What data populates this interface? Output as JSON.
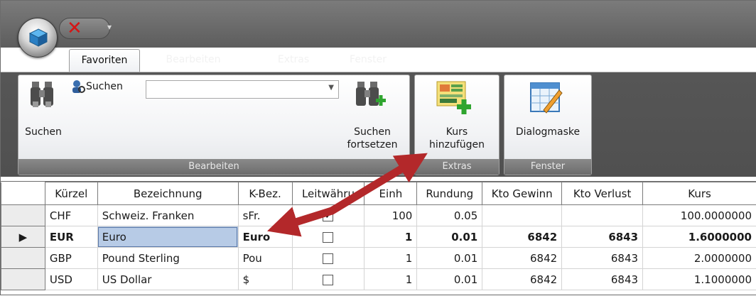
{
  "tabs": [
    {
      "label": "Favoriten",
      "active": true
    },
    {
      "label": "Bearbeiten",
      "active": false
    },
    {
      "label": "Extras",
      "active": false
    },
    {
      "label": "Fenster",
      "active": false
    }
  ],
  "ribbon": {
    "search_label": "Suchen",
    "search_combo_label": "Suchen",
    "search_combo_value": "",
    "continue_label_1": "Suchen",
    "continue_label_2": "fortsetzen",
    "kurs_label_1": "Kurs",
    "kurs_label_2": "hinzufügen",
    "dialog_label": "Dialogmaske",
    "group_bearbeiten": "Bearbeiten",
    "group_extras": "Extras",
    "group_fenster": "Fenster"
  },
  "grid": {
    "headers": [
      "Kürzel",
      "Bezeichnung",
      "K-Bez.",
      "Leitwähru",
      "Einh",
      "Rundung",
      "Kto Gewinn",
      "Kto Verlust",
      "Kurs"
    ],
    "rows": [
      {
        "kuerzel": "CHF",
        "bezeichnung": "Schweiz. Franken",
        "kbez": "sFr.",
        "leit": true,
        "einh": "100",
        "rundung": "0.05",
        "gewinn": "",
        "verlust": "",
        "kurs": "100.0000000"
      },
      {
        "kuerzel": "EUR",
        "bezeichnung": "Euro",
        "kbez": "Euro",
        "leit": false,
        "einh": "1",
        "rundung": "0.01",
        "gewinn": "6842",
        "verlust": "6843",
        "kurs": "1.6000000"
      },
      {
        "kuerzel": "GBP",
        "bezeichnung": "Pound Sterling",
        "kbez": "Pou",
        "leit": false,
        "einh": "1",
        "rundung": "0.01",
        "gewinn": "6842",
        "verlust": "6843",
        "kurs": "2.0000000"
      },
      {
        "kuerzel": "USD",
        "bezeichnung": "US Dollar",
        "kbez": "$",
        "leit": false,
        "einh": "1",
        "rundung": "0.01",
        "gewinn": "6842",
        "verlust": "6843",
        "kurs": "1.1000000"
      }
    ],
    "current_row_marker": "▶"
  },
  "colors": {
    "annotation_arrow": "#b3282a",
    "selection": "#b7cbe6"
  },
  "icons": [
    "app-cube-icon",
    "close-x-icon",
    "binoculars-icon",
    "user-search-icon",
    "binoculars-plus-icon",
    "add-rate-icon",
    "dialog-form-icon",
    "annotation-arrow"
  ]
}
